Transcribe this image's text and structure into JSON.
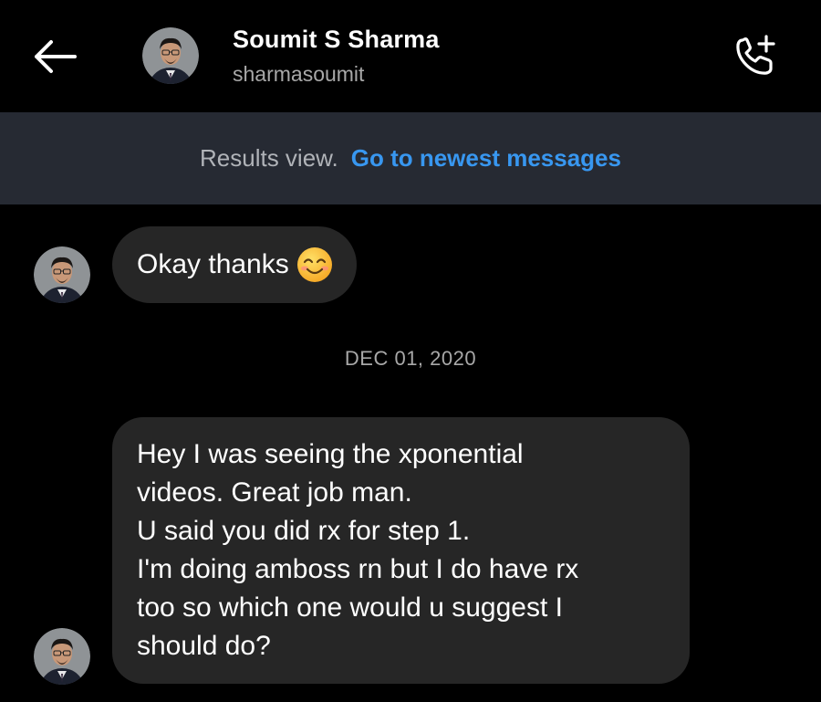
{
  "header": {
    "name": "Soumit S Sharma",
    "username": "sharmasoumit",
    "back_icon": "arrow-left-icon",
    "call_icon": "phone-plus-icon"
  },
  "banner": {
    "text": "Results view.",
    "link": "Go to newest messages"
  },
  "messages": [
    {
      "text": "Okay thanks",
      "emoji": "smiling-face-icon"
    },
    {
      "lines": [
        "Hey I was seeing the xponential",
        "videos. Great job man.",
        "U said you did rx for step 1.",
        "I'm doing amboss rn but I do have rx",
        "too so which one would u suggest I",
        "should do?"
      ]
    }
  ],
  "date_separator": "DEC 01, 2020",
  "colors": {
    "background": "#000000",
    "banner_bg": "#262a33",
    "bubble_bg": "#262626",
    "link": "#3897f0",
    "muted": "#a8a8a8"
  }
}
